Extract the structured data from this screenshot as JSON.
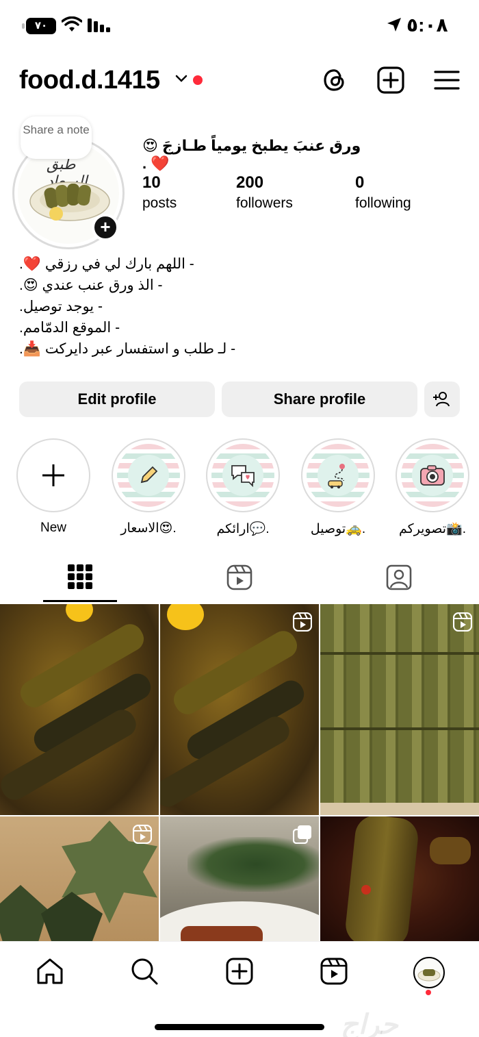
{
  "status_bar": {
    "time": "٥:٠٨",
    "battery": "٧٠"
  },
  "header": {
    "username": "food.d.1415"
  },
  "note": {
    "text": "Share a note"
  },
  "profile": {
    "display_name": "ورق عنبَ يطبخ يومياً طـازجَ 😍❤️ .",
    "avatar_text": "طبق السعاد",
    "stats": [
      {
        "value": "10",
        "label": "posts"
      },
      {
        "value": "200",
        "label": "followers"
      },
      {
        "value": "0",
        "label": "following"
      }
    ],
    "bio": [
      "- اللهم بارك لي في رزقي ❤️.",
      "- الذ ورق عنب عندي 😍.",
      "- يوجد توصيل.",
      "- الموقع الدمّامم.",
      "- لـ طلب و استفسار عبر دايركت 📥."
    ]
  },
  "buttons": {
    "edit": "Edit profile",
    "share": "Share profile"
  },
  "highlights": [
    {
      "label": "New"
    },
    {
      "label": "الاسعار😍."
    },
    {
      "label": "ارائكم💬."
    },
    {
      "label": "توصيل🚕."
    },
    {
      "label": "تصويركم📸."
    }
  ],
  "watermark": "حراج",
  "colors": {
    "accent_red": "#ff2a3a",
    "button_bg": "#efefef",
    "highlight_pink": "#f6d4d8",
    "highlight_mint": "#cfe8df"
  },
  "icons": [
    "threads-icon",
    "new-post-icon",
    "menu-icon",
    "grid-icon",
    "reels-icon",
    "tagged-icon",
    "home-icon",
    "search-icon",
    "create-icon",
    "reels-nav-icon",
    "profile-avatar-icon"
  ]
}
